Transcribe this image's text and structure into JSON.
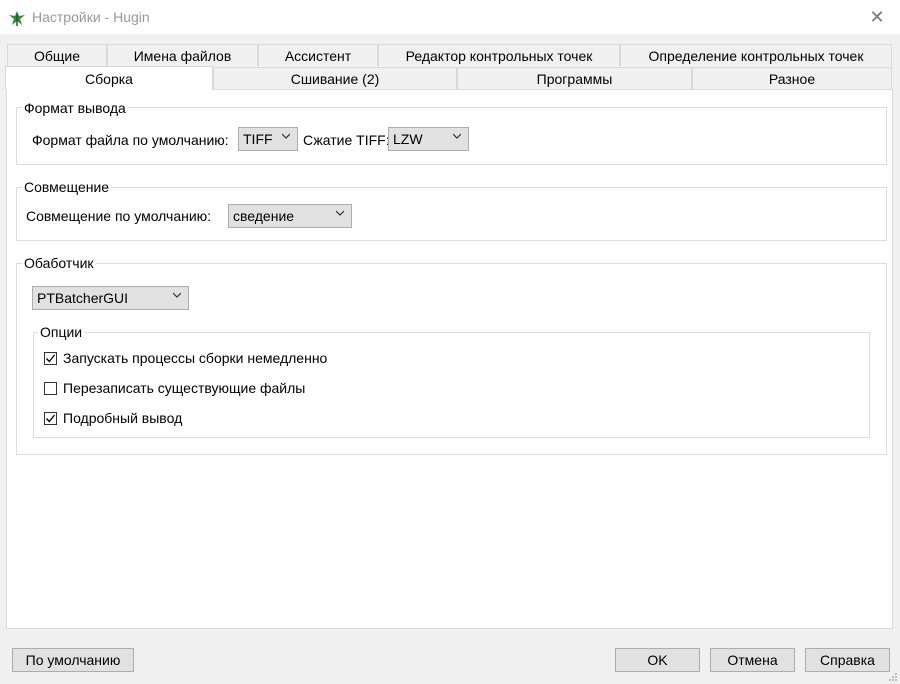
{
  "window": {
    "title": "Настройки - Hugin",
    "close_glyph": "✕"
  },
  "tabs_row1": [
    "Общие",
    "Имена файлов",
    "Ассистент",
    "Редактор контрольных точек",
    "Определение контрольных точек"
  ],
  "tabs_row2": [
    "Сборка",
    "Сшивание (2)",
    "Программы",
    "Разное"
  ],
  "active_tab": "Сборка",
  "output_format": {
    "title": "Формат вывода",
    "file_format_label": "Формат файла по умолчанию:",
    "file_format_value": "TIFF",
    "compression_label": "Сжатие TIFF:",
    "compression_value": "LZW"
  },
  "blending": {
    "title": "Совмещение",
    "default_label": "Совмещение по умолчанию:",
    "default_value": "сведение"
  },
  "processor": {
    "title": "Обаботчик",
    "value": "PTBatcherGUI",
    "options": {
      "title": "Опции",
      "items": [
        {
          "label": "Запускать процессы сборки немедленно",
          "checked": true
        },
        {
          "label": "Перезаписать существующие файлы",
          "checked": false
        },
        {
          "label": "Подробный вывод",
          "checked": true
        }
      ]
    }
  },
  "buttons": {
    "defaults": "По умолчанию",
    "ok": "OK",
    "cancel": "Отмена",
    "help": "Справка"
  }
}
